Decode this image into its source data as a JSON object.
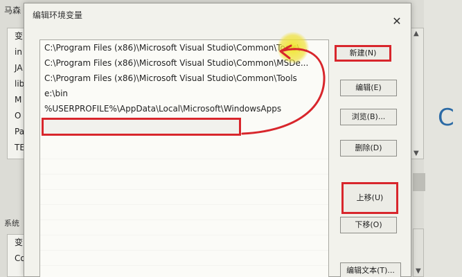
{
  "background_window": {
    "title": "马森",
    "list_top": [
      "变",
      "in",
      "JA",
      "lib",
      "M",
      "O",
      "Pa",
      "TE"
    ],
    "section_label": "系统",
    "list_bottom": [
      "变",
      "Co"
    ],
    "extra_text": "C"
  },
  "dialog": {
    "title": "编辑环境变量",
    "close_glyph": "✕",
    "paths": [
      "C:\\Program Files (x86)\\Microsoft Visual Studio\\Common\\Tools\\...",
      "C:\\Program Files (x86)\\Microsoft Visual Studio\\Common\\MSDe...",
      "C:\\Program Files (x86)\\Microsoft Visual Studio\\Common\\Tools",
      "e:\\bin",
      "%USERPROFILE%\\AppData\\Local\\Microsoft\\WindowsApps"
    ],
    "editing_value": ""
  },
  "buttons": {
    "new": "新建(N)",
    "edit": "编辑(E)",
    "browse": "浏览(B)...",
    "delete": "删除(D)",
    "move_up": "上移(U)",
    "move_down": "下移(O)",
    "edit_text": "编辑文本(T)..."
  },
  "colors": {
    "annotation_red": "#d8262c",
    "highlight_yellow": "#f0e628"
  },
  "icons": {
    "close": "close-icon",
    "scroll_up": "chevron-up-icon",
    "scroll_down": "chevron-down-icon"
  }
}
